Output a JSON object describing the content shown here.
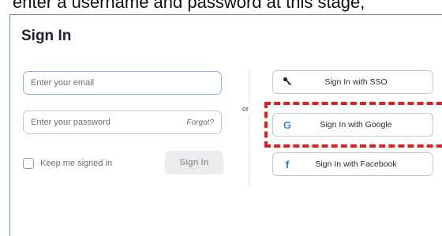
{
  "caption": "enter a username and password at this stage,",
  "form": {
    "title": "Sign In",
    "email_placeholder": "Enter your email",
    "password_placeholder": "Enter your password",
    "forgot": "Forgot?",
    "keep_signed_in": "Keep me signed in",
    "sign_in": "Sign In",
    "or": "or"
  },
  "sso": {
    "sso_label": "Sign In with SSO",
    "google_label": "Sign In with Google",
    "google_icon": "G",
    "facebook_label": "Sign In with Facebook",
    "facebook_icon": "f"
  },
  "colors": {
    "highlight": "#e02020",
    "google_blue": "#4285f4",
    "facebook_blue": "#1877f2"
  }
}
